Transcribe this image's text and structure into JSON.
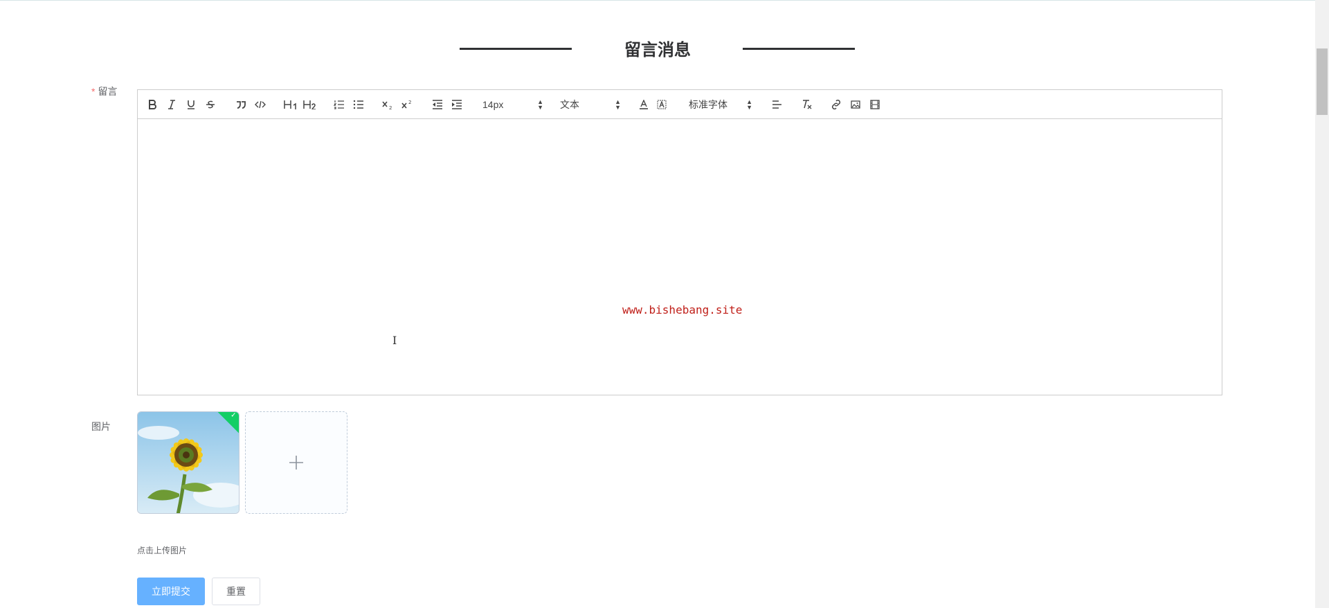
{
  "page": {
    "title": "留言消息"
  },
  "form": {
    "message_label": "留言",
    "message_required_mark": "*",
    "image_label": "图片",
    "upload_tip": "点击上传图片",
    "submit_label": "立即提交",
    "reset_label": "重置"
  },
  "toolbar": {
    "buttons": [
      "bold-icon",
      "italic-icon",
      "underline-icon",
      "strikethrough-icon",
      "blockquote-icon",
      "code-block-icon",
      "header-1-icon",
      "header-2-icon",
      "ordered-list-icon",
      "bullet-list-icon",
      "subscript-icon",
      "superscript-icon",
      "outdent-icon",
      "indent-icon",
      "font-color-icon",
      "background-color-icon",
      "align-icon",
      "clean-format-icon",
      "link-icon",
      "image-icon",
      "video-icon"
    ],
    "size_select": "14px",
    "header_select": "文本",
    "font_select": "标准字体"
  },
  "editor": {
    "watermark": "www.bishebang.site"
  },
  "colors": {
    "primary_button": "#66b1ff",
    "required_mark": "#f56c6c",
    "success_badge": "#13ce66",
    "watermark": "#c0201a"
  }
}
